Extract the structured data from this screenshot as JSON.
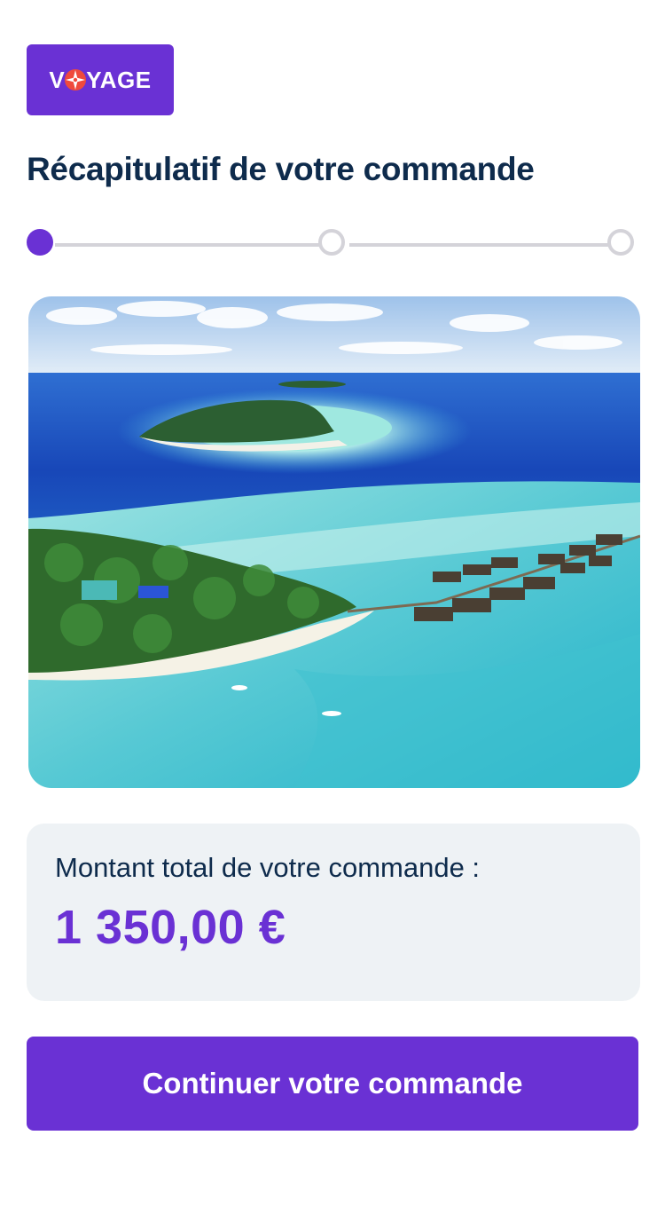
{
  "brand": {
    "logo_text": "VOYAGE",
    "logo_prefix": "V",
    "logo_suffix": "YAGE",
    "logo_icon": "compass-rose-icon",
    "colors": {
      "primary": "#6a31d4",
      "accent": "#ef4a3c",
      "heading": "#0e2b4c"
    }
  },
  "page": {
    "title": "Récapitulatif de votre commande"
  },
  "stepper": {
    "current_step": 1,
    "steps": [
      {
        "state": "active"
      },
      {
        "state": "inactive"
      },
      {
        "state": "inactive"
      }
    ]
  },
  "hero": {
    "image": "maldives-island-aerial-photo"
  },
  "order_total": {
    "label": "Montant total de votre commande :",
    "amount": "1 350,00 €"
  },
  "actions": {
    "continue_label": "Continuer votre commande"
  }
}
